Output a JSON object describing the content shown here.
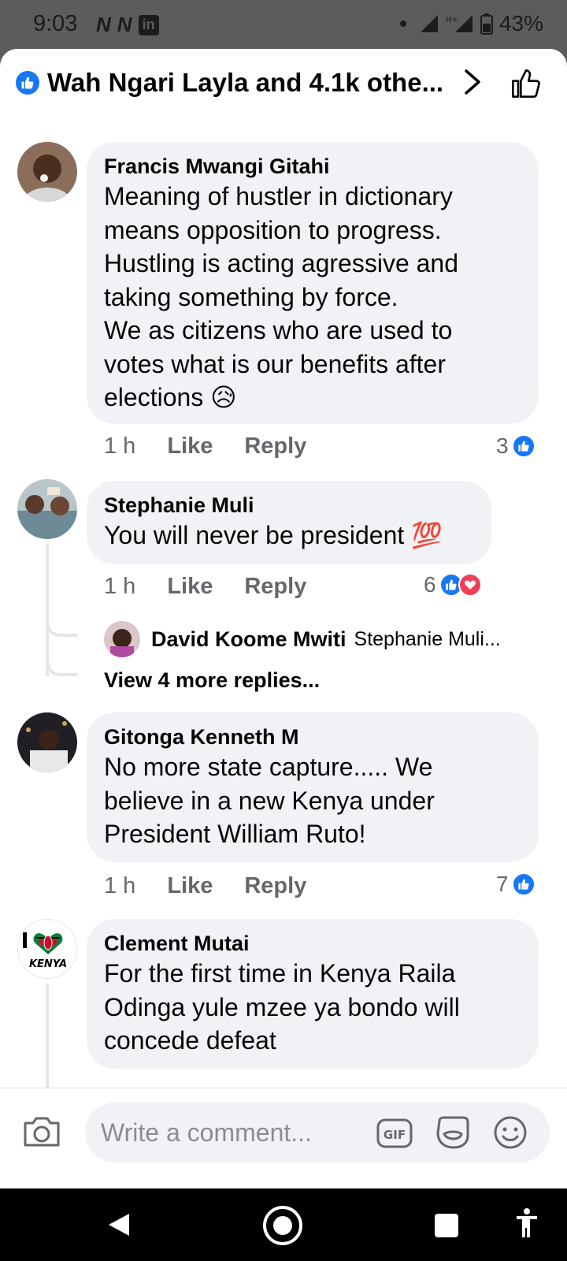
{
  "status": {
    "time": "9:03",
    "left_icons": [
      "N",
      "N"
    ],
    "linkedin": "in",
    "battery": "43%"
  },
  "header": {
    "title": "Wah Ngari Layla and 4.1k othe..."
  },
  "comments": [
    {
      "author": "Francis Mwangi Gitahi",
      "lines": [
        "Meaning of hustler in dictionary",
        "means opposition to progress.",
        "Hustling is acting agressive and",
        "taking something by force.",
        "We as citizens who are used to",
        "votes what is our benefits after",
        "elections 😥"
      ],
      "time": "1 h",
      "like_label": "Like",
      "reply_label": "Reply",
      "reaction_count": "3"
    },
    {
      "author": "Stephanie Muli",
      "lines": [
        "You will never be president 💯"
      ],
      "time": "1 h",
      "like_label": "Like",
      "reply_label": "Reply",
      "reaction_count": "6"
    },
    {
      "author": "Gitonga Kenneth M",
      "lines": [
        "No more state capture..... We",
        "believe in a new Kenya under",
        "President William Ruto!"
      ],
      "time": "1 h",
      "like_label": "Like",
      "reply_label": "Reply",
      "reaction_count": "7"
    },
    {
      "author": "Clement Mutai",
      "lines": [
        "For the first time in Kenya Raila",
        "Odinga yule mzee ya bondo will",
        "concede defeat"
      ]
    }
  ],
  "reply_preview": {
    "author": "David Koome Mwiti",
    "snippet": "Stephanie Muli...",
    "view_more": "View 4 more replies..."
  },
  "kenya_avatar_text": "KENYA",
  "composer": {
    "placeholder": "Write a comment...",
    "gif_label": "GIF"
  },
  "colors": {
    "accent": "#1877f2",
    "love": "#f33e58",
    "bubble": "#f0f2f5",
    "meta": "#65676b"
  }
}
